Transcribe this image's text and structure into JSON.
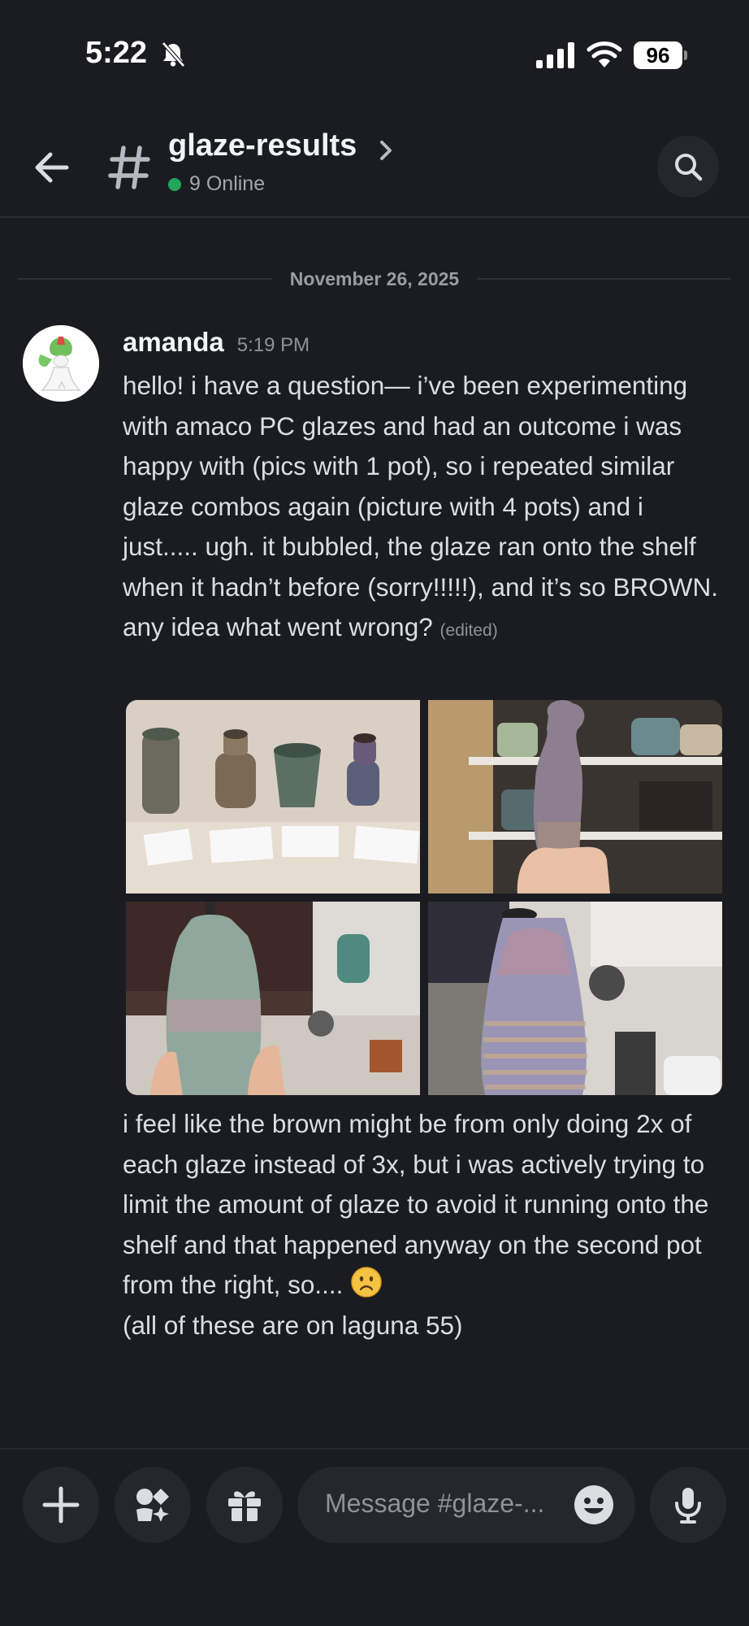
{
  "status_bar": {
    "time": "5:22",
    "battery": "96",
    "icons": [
      "bell-slash-icon",
      "cellular-signal-icon",
      "wifi-icon",
      "battery-icon"
    ]
  },
  "header": {
    "channel_name": "glaze-results",
    "online": "9 Online",
    "icons": [
      "back-arrow-icon",
      "hash-icon",
      "chevron-right-icon",
      "search-icon"
    ]
  },
  "divider": {
    "date": "November 26, 2025"
  },
  "message": {
    "author": "amanda",
    "timestamp": "5:19 PM",
    "text_first": "hello! i have a question— i’ve been experimenting with amaco PC glazes and had an outcome i was happy with (pics with 1 pot), so i repeated similar glaze combos again (picture with 4 pots) and i just..... ugh. it bubbled, the glaze ran onto the shelf when it hadn’t before (sorry!!!!!), and it’s so BROWN. any idea what went wrong?",
    "edited": "(edited)",
    "text_second": "i feel like the brown might be from only doing 2x of each glaze instead of 3x, but i was actively trying to limit the amount of glaze to avoid it running onto the shelf and that happened anyway on the second pot from the right, so.... ",
    "text_third": "(all of these are on laguna 55)",
    "attachments": [
      "four-pots-photo",
      "single-pot-shelf-photo",
      "pot-kitchen-photo",
      "pot-closeup-photo"
    ],
    "emoji": "slightly-frowning-face"
  },
  "composer": {
    "placeholder": "Message #glaze-...",
    "icons": [
      "plus-icon",
      "apps-icon",
      "gift-icon",
      "emoji-icon",
      "microphone-icon"
    ]
  },
  "colors": {
    "background": "#1b1c22",
    "online_dot": "#23a55a",
    "button_bg": "#26272d"
  }
}
